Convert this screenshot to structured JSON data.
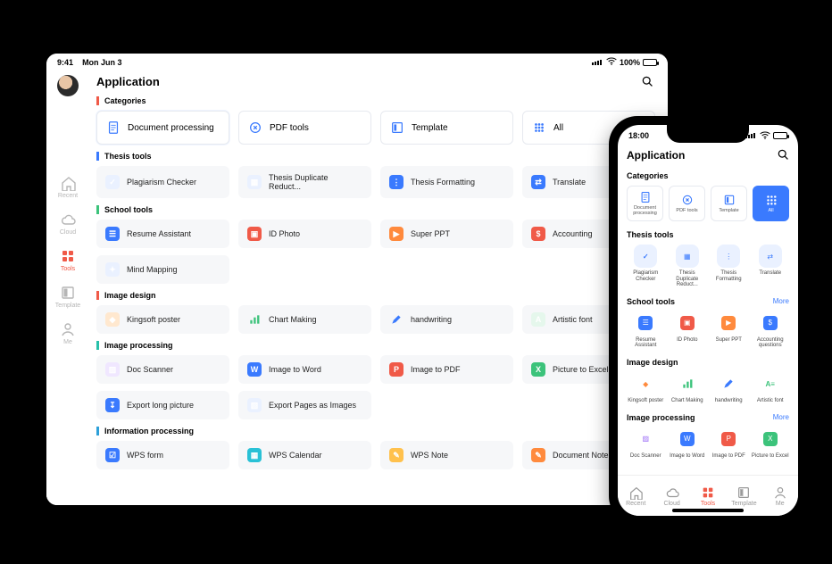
{
  "tablet": {
    "status": {
      "time": "9:41",
      "date": "Mon Jun 3",
      "battery": "100%"
    },
    "app_title": "Application",
    "sidebar": {
      "items": [
        {
          "id": "recent",
          "label": "Recent"
        },
        {
          "id": "cloud",
          "label": "Cloud"
        },
        {
          "id": "tools",
          "label": "Tools"
        },
        {
          "id": "template",
          "label": "Template"
        },
        {
          "id": "me",
          "label": "Me"
        }
      ],
      "active": "tools"
    },
    "sections": {
      "categories": {
        "label": "Categories",
        "items": [
          "Document processing",
          "PDF tools",
          "Template",
          "All"
        ]
      },
      "thesis": {
        "label": "Thesis tools",
        "items": [
          "Plagiarism Checker",
          "Thesis Duplicate Reduct...",
          "Thesis Formatting",
          "Translate"
        ]
      },
      "school": {
        "label": "School tools",
        "items": [
          "Resume Assistant",
          "ID Photo",
          "Super PPT",
          "Accounting",
          "Mind Mapping"
        ]
      },
      "image_design": {
        "label": "Image design",
        "items": [
          "Kingsoft poster",
          "Chart Making",
          "handwriting",
          "Artistic font"
        ]
      },
      "image_processing": {
        "label": "Image processing",
        "items": [
          "Doc Scanner",
          "Image to Word",
          "Image to PDF",
          "Picture to Excel",
          "Export long picture",
          "Export Pages as Images"
        ]
      },
      "info_processing": {
        "label": "Information processing",
        "items": [
          "WPS form",
          "WPS Calendar",
          "WPS Note",
          "Document Note"
        ]
      }
    }
  },
  "phone": {
    "status": {
      "time": "18:00"
    },
    "app_title": "Application",
    "categories": {
      "label": "Categories",
      "items": [
        "Document processing",
        "PDF tools",
        "Template",
        "All"
      ],
      "active": "All"
    },
    "thesis": {
      "label": "Thesis tools",
      "items": [
        "Plagiarism Checker",
        "Thesis Duplicate Reduct...",
        "Thesis Formatting",
        "Translate"
      ]
    },
    "school": {
      "label": "School tools",
      "more": "More",
      "items": [
        "Resume Assistant",
        "ID Photo",
        "Super PPT",
        "Accounting questions"
      ]
    },
    "image_design": {
      "label": "Image design",
      "items": [
        "Kingsoft poster",
        "Chart Making",
        "handwriting",
        "Artistic font"
      ]
    },
    "image_processing": {
      "label": "Image processing",
      "more": "More",
      "items": [
        "Doc Scanner",
        "Image to Word",
        "Image to PDF",
        "Picture to Excel"
      ]
    },
    "tabbar": {
      "items": [
        {
          "id": "recent",
          "label": "Recent"
        },
        {
          "id": "cloud",
          "label": "Cloud"
        },
        {
          "id": "tools",
          "label": "Tools"
        },
        {
          "id": "template",
          "label": "Template"
        },
        {
          "id": "me",
          "label": "Me"
        }
      ],
      "active": "tools"
    }
  }
}
